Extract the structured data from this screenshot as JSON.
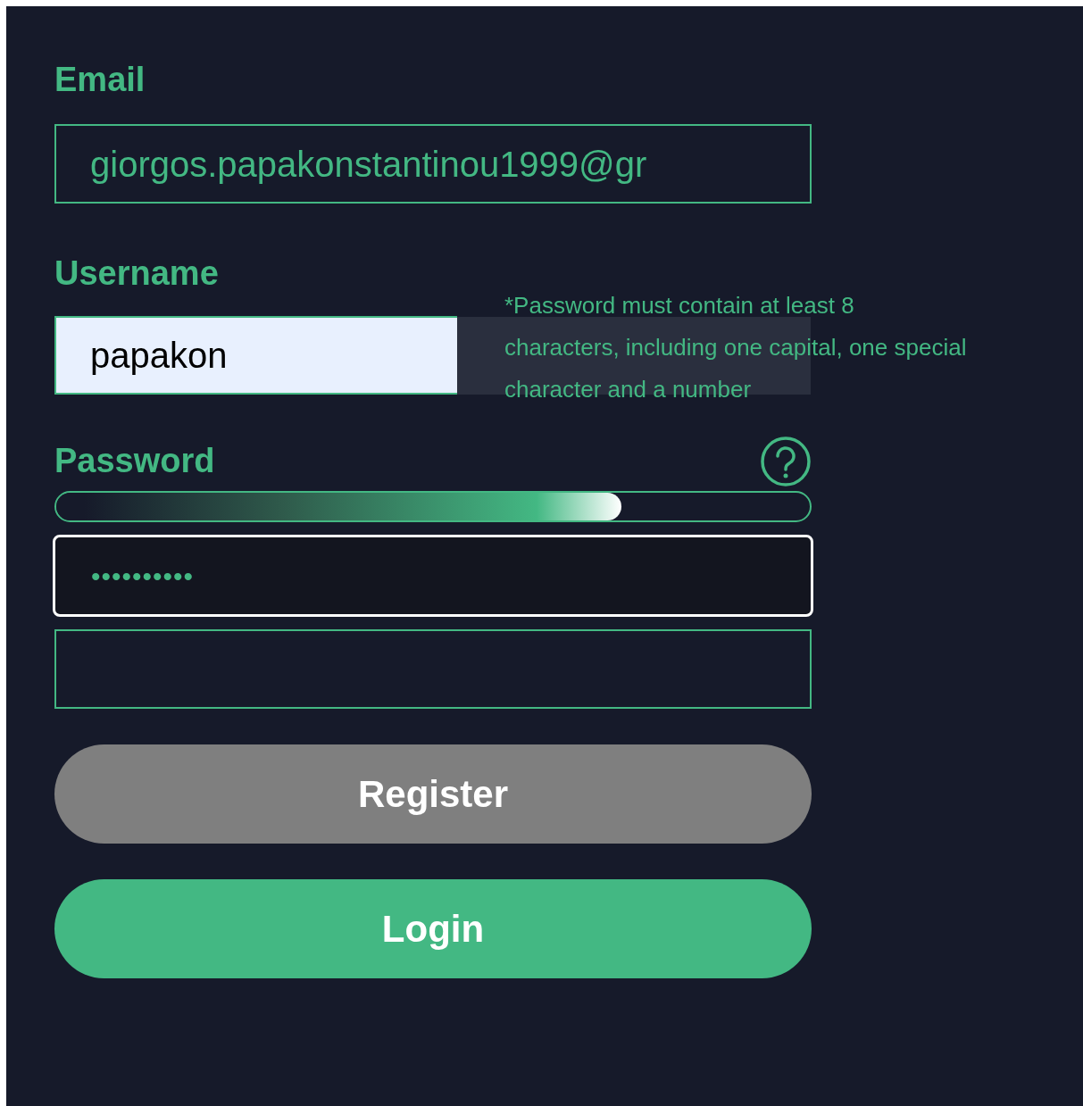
{
  "email": {
    "label": "Email",
    "value": "giorgos.papakonstantinou1999@gr"
  },
  "username": {
    "label": "Username",
    "value": "papakon"
  },
  "password": {
    "label": "Password",
    "strength": {
      "level": 0.75
    },
    "value": "••••••••••",
    "focused": true
  },
  "tooltip": {
    "lines": [
      "*Password must contain at least 8",
      "characters, including one capital, one special",
      "character and a number"
    ]
  },
  "buttons": [
    {
      "label": "Register",
      "kind": "secondary"
    },
    {
      "label": "Login",
      "kind": "primary"
    }
  ]
}
